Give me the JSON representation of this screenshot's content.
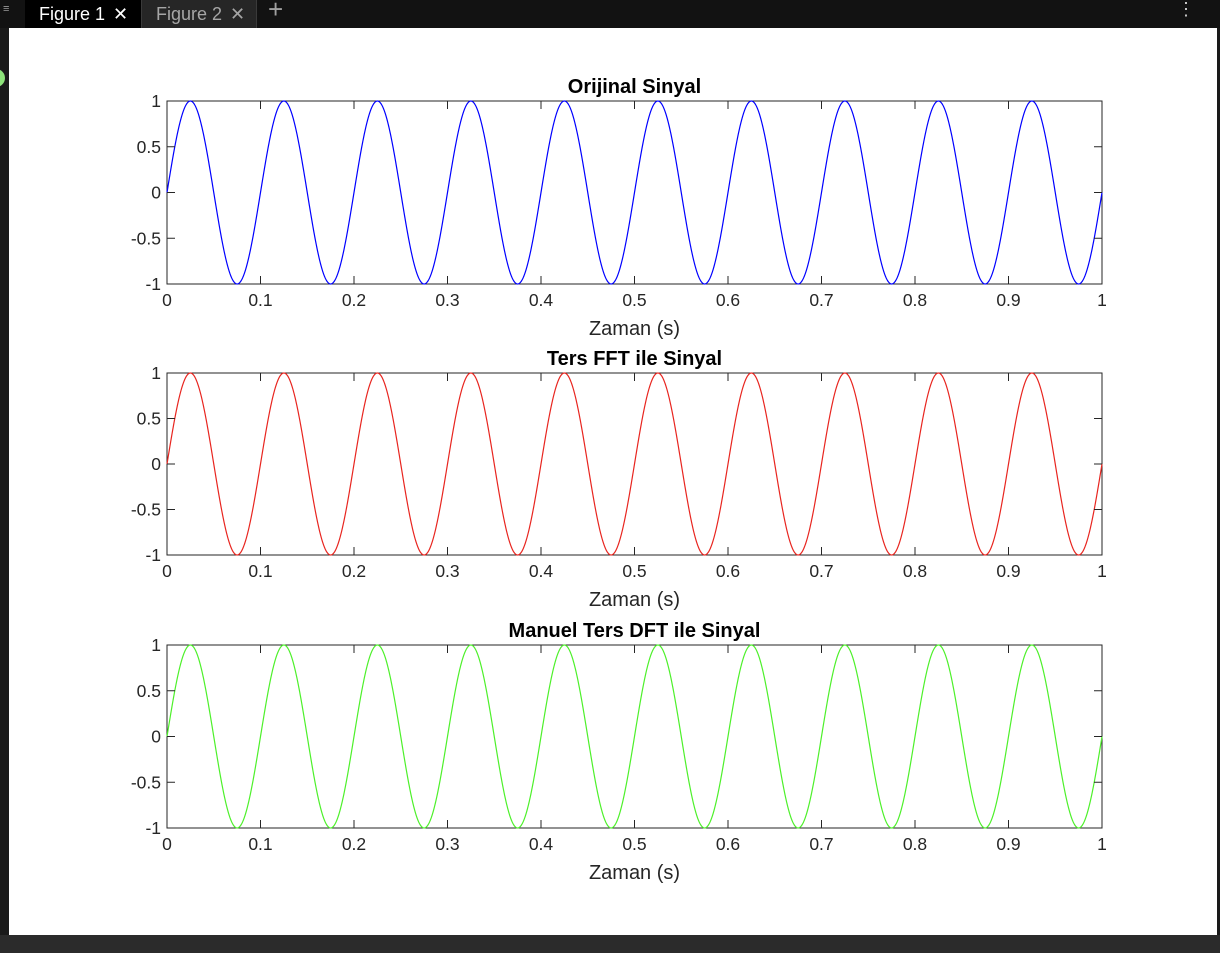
{
  "tabs": [
    {
      "label": "Figure 1",
      "active": true
    },
    {
      "label": "Figure 2",
      "active": false
    }
  ],
  "toolbar": {
    "add_tab_icon": "plus-icon",
    "more_icon": "vertical-ellipsis-icon",
    "close_icon": "close-x-icon"
  },
  "chart_data": [
    {
      "type": "line",
      "title": "Orijinal Sinyal",
      "xlabel": "Zaman (s)",
      "ylabel": "",
      "xlim": [
        0,
        1
      ],
      "ylim": [
        -1,
        1
      ],
      "xticks": [
        "0",
        "0.1",
        "0.2",
        "0.3",
        "0.4",
        "0.5",
        "0.6",
        "0.7",
        "0.8",
        "0.9",
        "1"
      ],
      "yticks": [
        "1",
        "0.5",
        "0",
        "-0.5",
        "-1"
      ],
      "series": [
        {
          "function": "sin(2*pi*10*t)",
          "frequency_hz": 10,
          "amplitude": 1,
          "t_range": [
            0,
            1
          ],
          "color": "#0000ff"
        }
      ]
    },
    {
      "type": "line",
      "title": "Ters FFT ile Sinyal",
      "xlabel": "Zaman (s)",
      "ylabel": "",
      "xlim": [
        0,
        1
      ],
      "ylim": [
        -1,
        1
      ],
      "xticks": [
        "0",
        "0.1",
        "0.2",
        "0.3",
        "0.4",
        "0.5",
        "0.6",
        "0.7",
        "0.8",
        "0.9",
        "1"
      ],
      "yticks": [
        "1",
        "0.5",
        "0",
        "-0.5",
        "-1"
      ],
      "series": [
        {
          "function": "sin(2*pi*10*t)",
          "frequency_hz": 10,
          "amplitude": 1,
          "t_range": [
            0,
            1
          ],
          "color": "#e8251f"
        }
      ]
    },
    {
      "type": "line",
      "title": "Manuel Ters DFT ile Sinyal",
      "xlabel": "Zaman (s)",
      "ylabel": "",
      "xlim": [
        0,
        1
      ],
      "ylim": [
        -1,
        1
      ],
      "xticks": [
        "0",
        "0.1",
        "0.2",
        "0.3",
        "0.4",
        "0.5",
        "0.6",
        "0.7",
        "0.8",
        "0.9",
        "1"
      ],
      "yticks": [
        "1",
        "0.5",
        "0",
        "-0.5",
        "-1"
      ],
      "series": [
        {
          "function": "sin(2*pi*10*t)",
          "frequency_hz": 10,
          "amplitude": 1,
          "t_range": [
            0,
            1
          ],
          "color": "#4df02a"
        }
      ]
    }
  ]
}
